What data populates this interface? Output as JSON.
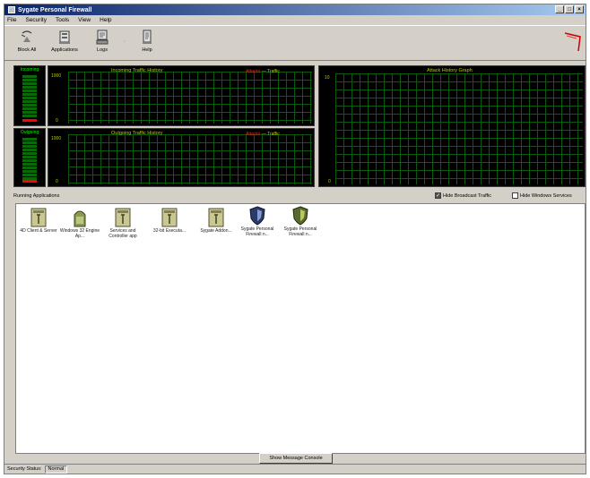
{
  "window": {
    "title": "Sygate Personal Firewall",
    "controls": [
      "_",
      "□",
      "×"
    ]
  },
  "menu": [
    "File",
    "Security",
    "Tools",
    "View",
    "Help"
  ],
  "toolbar": {
    "buttons": [
      {
        "label": "Block All",
        "icon": "block-all-icon"
      },
      {
        "label": "Applications",
        "icon": "applications-icon"
      },
      {
        "label": "Logs",
        "icon": "logs-icon"
      },
      {
        "label": "Help",
        "icon": "help-icon"
      }
    ],
    "logo": "sygate-logo"
  },
  "traffic": {
    "incoming": {
      "meter_label": "Incoming",
      "title": "Incoming Traffic History",
      "ytop": "1000",
      "ybottom": "0",
      "legend_red": "Attacks",
      "legend_green": "Traffic"
    },
    "outgoing": {
      "meter_label": "Outgoing",
      "title": "Outgoing Traffic History",
      "ytop": "1000",
      "ybottom": "0",
      "legend_red": "Attacks",
      "legend_green": "Traffic"
    },
    "attack": {
      "title": "Attack History Graph",
      "ytop": "10",
      "ybottom": "0"
    },
    "colors": {
      "grid": "#0d5a0d",
      "text": "#b8c800",
      "attack": "#ff0000",
      "bg": "#000000"
    }
  },
  "options": {
    "section_label": "Running Applications",
    "hide_broadcast": {
      "label": "Hide Broadcast Traffic",
      "checked": true
    },
    "hide_windows_services": {
      "label": "Hide Windows Services",
      "checked": false
    }
  },
  "apps": [
    {
      "name": "4D Client & Server",
      "icon": "generic-app-icon"
    },
    {
      "name": "Windows 32 Engine Ap...",
      "icon": "system-app-icon"
    },
    {
      "name": "Services and Controller app",
      "icon": "generic-app-icon"
    },
    {
      "name": "32-bit Executa...",
      "icon": "generic-app-icon"
    },
    {
      "name": "Sygate Addon...",
      "icon": "generic-app-icon"
    },
    {
      "name": "Sygate Personal Firewall n...",
      "icon": "shield-app-icon"
    },
    {
      "name": "Sygate Personal Firewall n...",
      "icon": "shield-green-app-icon"
    }
  ],
  "bottom_button": "Show Message Console",
  "status": {
    "label": "Security Status:",
    "value": "Normal"
  }
}
